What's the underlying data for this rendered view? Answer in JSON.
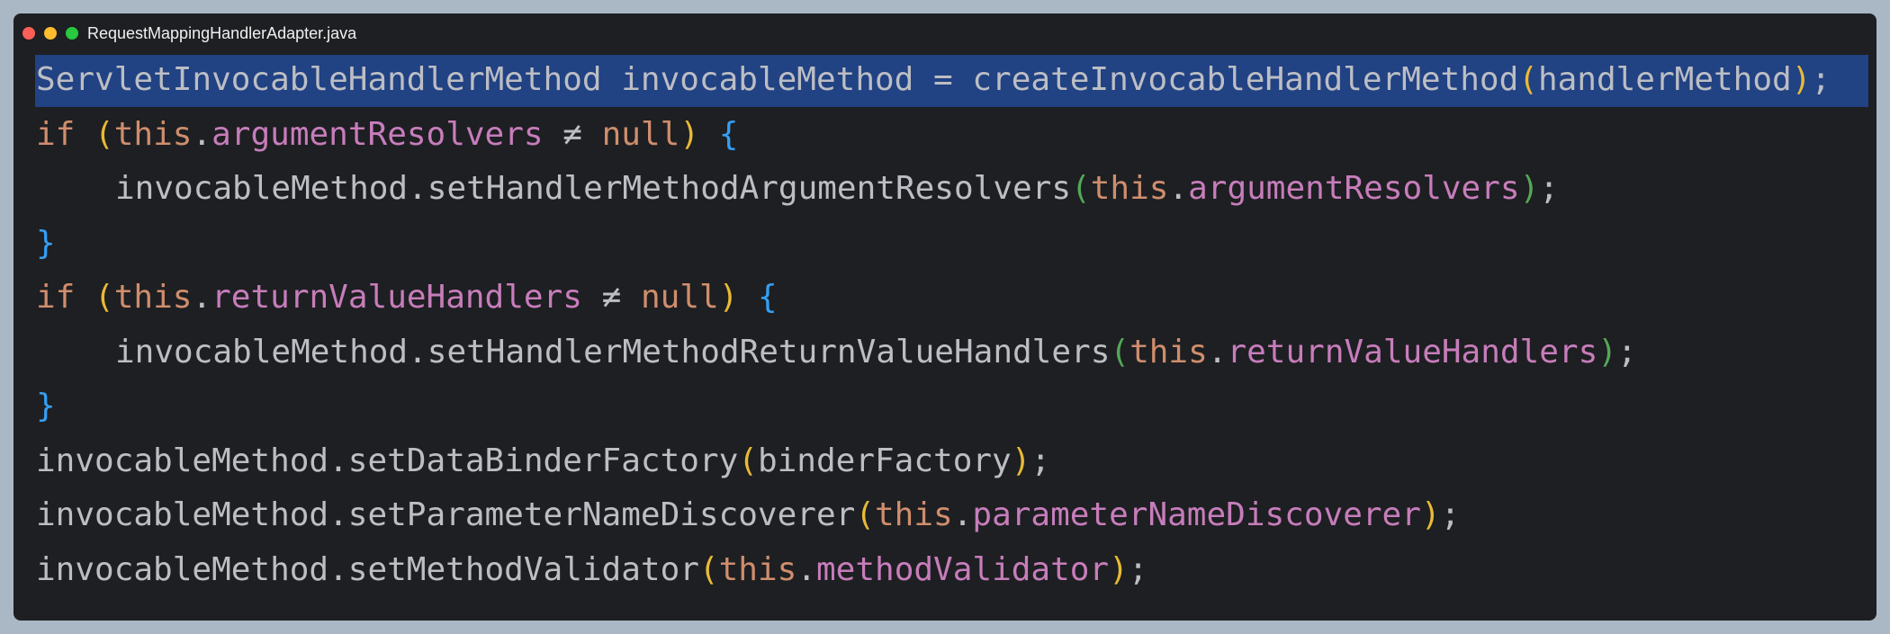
{
  "window": {
    "title": "RequestMappingHandlerAdapter.java"
  },
  "code": {
    "line1": {
      "type": "ServletInvocableHandlerMethod",
      "var": "invocableMethod",
      "assign": " = ",
      "call": "createInvocableHandlerMethod",
      "open": "(",
      "arg": "handlerMethod",
      "close": ")",
      "semi": ";"
    },
    "line2": {
      "kw_if": "if",
      "open": "(",
      "kw_this": "this",
      "dot": ".",
      "field": "argumentResolvers",
      "op": " ≠ ",
      "kw_null": "null",
      "close": ")",
      "brace": "{"
    },
    "line3": {
      "target": "invocableMethod",
      "method": ".setHandlerMethodArgumentResolvers",
      "open": "(",
      "kw_this": "this",
      "dot": ".",
      "field": "argumentResolvers",
      "close": ")",
      "semi": ";"
    },
    "line4": {
      "brace": "}"
    },
    "line5": {
      "kw_if": "if",
      "open": "(",
      "kw_this": "this",
      "dot": ".",
      "field": "returnValueHandlers",
      "op": " ≠ ",
      "kw_null": "null",
      "close": ")",
      "brace": "{"
    },
    "line6": {
      "target": "invocableMethod",
      "method": ".setHandlerMethodReturnValueHandlers",
      "open": "(",
      "kw_this": "this",
      "dot": ".",
      "field": "returnValueHandlers",
      "close": ")",
      "semi": ";"
    },
    "line7": {
      "brace": "}"
    },
    "line8": {
      "target": "invocableMethod",
      "method": ".setDataBinderFactory",
      "open": "(",
      "arg": "binderFactory",
      "close": ")",
      "semi": ";"
    },
    "line9": {
      "target": "invocableMethod",
      "method": ".setParameterNameDiscoverer",
      "open": "(",
      "kw_this": "this",
      "dot": ".",
      "field": "parameterNameDiscoverer",
      "close": ")",
      "semi": ";"
    },
    "line10": {
      "target": "invocableMethod",
      "method": ".setMethodValidator",
      "open": "(",
      "kw_this": "this",
      "dot": ".",
      "field": "methodValidator",
      "close": ")",
      "semi": ";"
    }
  },
  "colors": {
    "background": "#a9b8c4",
    "editor_background": "#1e1f22",
    "selection": "#214283",
    "keyword": "#cf8e6d",
    "field": "#c77dbb",
    "identifier": "#bcbec4",
    "bracket_level1": "#e8ba36",
    "bracket_level2": "#54a857",
    "bracket_level3": "#359ff4",
    "traffic_close": "#ff5f57",
    "traffic_minimize": "#febc2e",
    "traffic_zoom": "#28c840"
  }
}
